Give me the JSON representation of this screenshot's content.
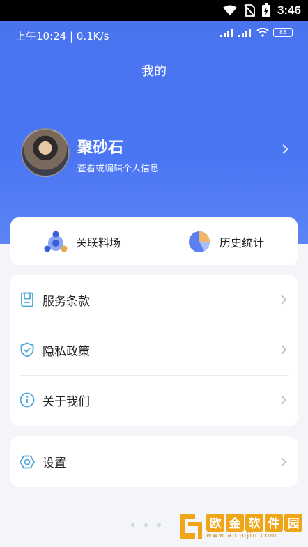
{
  "system": {
    "time": "3:46"
  },
  "status": {
    "left": "上午10:24 | 0.1K/s",
    "battery": "85"
  },
  "header": {
    "title": "我的"
  },
  "profile": {
    "name": "聚砂石",
    "subtitle": "查看或编辑个人信息"
  },
  "quick_actions": [
    {
      "label": "关联料场",
      "icon": "linked-yard-icon"
    },
    {
      "label": "历史统计",
      "icon": "pie-chart-icon"
    }
  ],
  "menu": [
    {
      "label": "服务条款",
      "icon": "document-icon"
    },
    {
      "label": "隐私政策",
      "icon": "shield-icon"
    },
    {
      "label": "关于我们",
      "icon": "info-icon"
    }
  ],
  "settings": {
    "label": "设置",
    "icon": "hexagon-settings-icon"
  },
  "watermark": {
    "chars": [
      "欧",
      "金",
      "软",
      "件",
      "园"
    ],
    "url": "www.apoujin.com"
  },
  "colors": {
    "accent": "#4a73f0",
    "icon_teal": "#4aa7d6"
  }
}
